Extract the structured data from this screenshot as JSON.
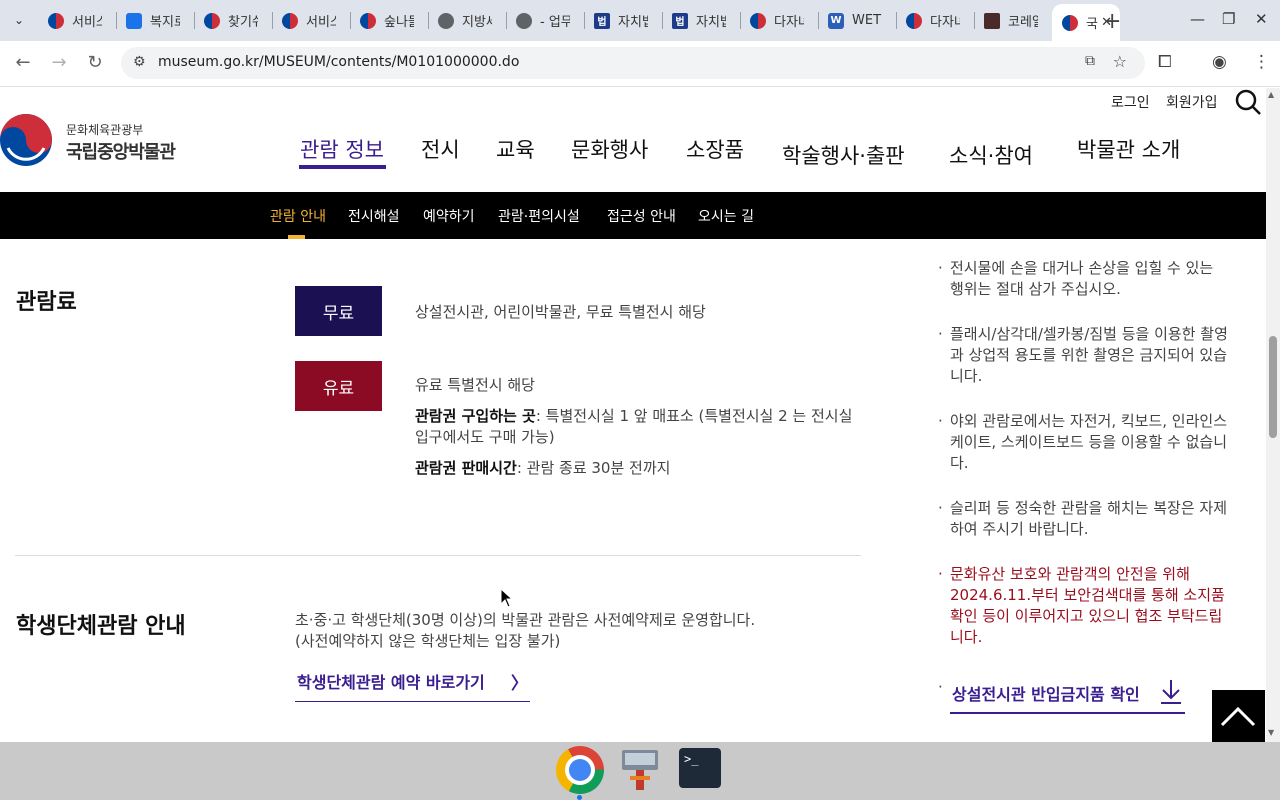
{
  "browser": {
    "tabs": [
      {
        "title": "서비스",
        "icon": "korea-flag-icon"
      },
      {
        "title": "복지로",
        "icon": "blue-site-icon"
      },
      {
        "title": "찾기쉬",
        "icon": "korea-flag-icon"
      },
      {
        "title": "서비스",
        "icon": "korea-flag-icon"
      },
      {
        "title": "숲나들",
        "icon": "korea-flag-icon"
      },
      {
        "title": "지방세",
        "icon": "globe-icon"
      },
      {
        "title": "- 업무",
        "icon": "globe-icon"
      },
      {
        "title": "자치법",
        "icon": "law-icon"
      },
      {
        "title": "자치법",
        "icon": "law-icon"
      },
      {
        "title": "다자녀",
        "icon": "korea-flag-icon"
      },
      {
        "title": "WET",
        "icon": "w-icon"
      },
      {
        "title": "다자녀",
        "icon": "korea-flag-icon"
      },
      {
        "title": "코레일",
        "icon": "korail-icon"
      },
      {
        "title": "국",
        "icon": "korea-flag-icon",
        "active": true
      }
    ],
    "url": "museum.go.kr/MUSEUM/contents/M0101000000.do"
  },
  "header": {
    "login": "로그인",
    "signup": "회원가입",
    "logo_ministry": "문화체육관광부",
    "logo_name": "국립중앙박물관",
    "gnb": [
      "관람 정보",
      "전시",
      "교육",
      "문화행사",
      "소장품",
      "학술행사·출판",
      "소식·참여",
      "박물관 소개"
    ],
    "subnav": [
      "관람 안내",
      "전시해설",
      "예약하기",
      "관람·편의시설",
      "접근성 안내",
      "오시는 길"
    ]
  },
  "fees": {
    "heading": "관람료",
    "free_label": "무료",
    "free_desc": "상설전시관, 어린이박물관, 무료 특별전시 해당",
    "paid_label": "유료",
    "paid_desc": "유료 특별전시 해당",
    "buy_where_label": "관람권 구입하는 곳",
    "buy_where_value": ": 특별전시실 1 앞 매표소 (특별전시실 2 는 전시실 입구에서도 구매 가능)",
    "sale_time_label": "관람권 판매시간",
    "sale_time_value": ": 관람 종료 30분 전까지"
  },
  "students": {
    "heading": "학생단체관람 안내",
    "line1": "초·중·고 학생단체(30명 이상)의 박물관 관람은 사전예약제로 운영합니다.",
    "line2": "(사전예약하지 않은 학생단체는 입장 불가)",
    "link": "학생단체관람 예약 바로가기"
  },
  "rules": [
    "전시물에 손을 대거나 손상을 입힐 수 있는 행위는 절대 삼가 주십시오.",
    "플래시/삼각대/셀카봉/짐벌 등을 이용한 촬영과 상업적 용도를 위한 촬영은 금지되어 있습니다.",
    "야외 관람로에서는 자전거, 킥보드, 인라인스케이트, 스케이트보드 등을 이용할 수 없습니다.",
    "슬리퍼 등 정숙한 관람을 해치는 복장은 자제하여 주시기 바랍니다.",
    "문화유산 보호와 관람객의 안전을 위해 2024.6.11.부터 보안검색대를 통해 소지품 확인 등이 이루어지고 있으니 협조 부탁드립니다."
  ],
  "ban_link": "상설전시관 반입금지품 확인",
  "colors": {
    "primary": "#3a1d8f",
    "free_badge": "#1b1152",
    "paid_badge": "#8b0b24",
    "subnav_active": "#f2b233",
    "notice_red": "#9b0d1b"
  }
}
